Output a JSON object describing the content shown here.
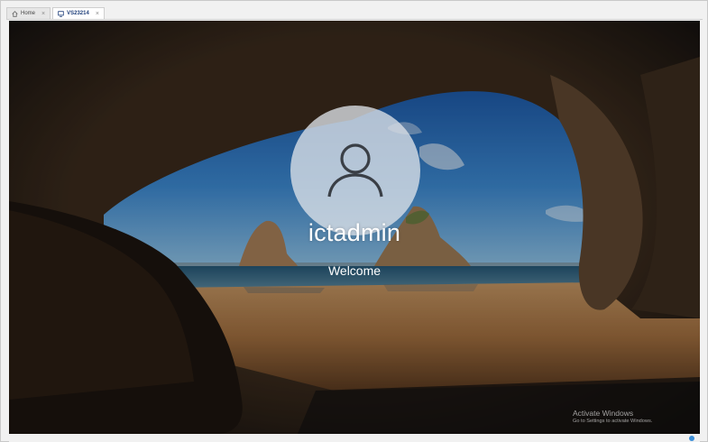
{
  "client": {
    "tabs": [
      {
        "label": "Home",
        "icon": "home-icon"
      },
      {
        "label": "VS23214",
        "icon": "vm-icon",
        "active": true
      }
    ]
  },
  "lock_screen": {
    "username": "ictadmin",
    "status": "Welcome",
    "avatar_icon": "user-icon"
  },
  "watermark": {
    "title": "Activate Windows",
    "subtitle": "Go to Settings to activate Windows."
  },
  "colors": {
    "sky": "#2f78c4",
    "sand": "#b07a45",
    "cave": "#0c0d0f"
  }
}
